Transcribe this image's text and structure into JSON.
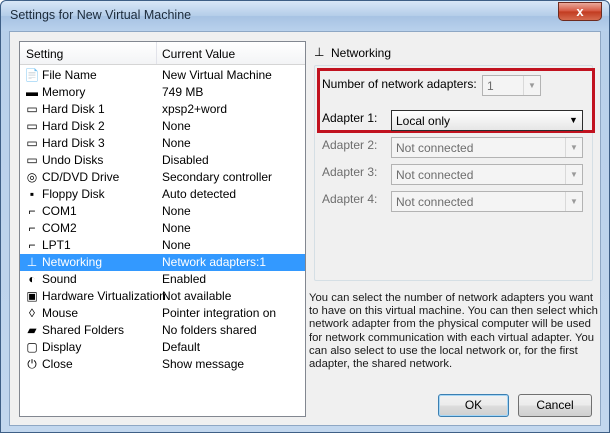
{
  "window": {
    "title": "Settings for New Virtual Machine",
    "close_glyph": "x"
  },
  "list": {
    "columns": [
      "Setting",
      "Current Value"
    ],
    "rows": [
      {
        "icon": "file-icon",
        "glyph": "📄",
        "name": "File Name",
        "value": "New Virtual Machine",
        "selected": false
      },
      {
        "icon": "memory-icon",
        "glyph": "▬",
        "name": "Memory",
        "value": "749 MB",
        "selected": false
      },
      {
        "icon": "hard-disk-icon",
        "glyph": "▭",
        "name": "Hard Disk 1",
        "value": "xpsp2+word",
        "selected": false
      },
      {
        "icon": "hard-disk-icon",
        "glyph": "▭",
        "name": "Hard Disk 2",
        "value": "None",
        "selected": false
      },
      {
        "icon": "hard-disk-icon",
        "glyph": "▭",
        "name": "Hard Disk 3",
        "value": "None",
        "selected": false
      },
      {
        "icon": "undo-disks-icon",
        "glyph": "▭",
        "name": "Undo Disks",
        "value": "Disabled",
        "selected": false
      },
      {
        "icon": "cd-dvd-icon",
        "glyph": "◎",
        "name": "CD/DVD Drive",
        "value": "Secondary controller",
        "selected": false
      },
      {
        "icon": "floppy-disk-icon",
        "glyph": "▪",
        "name": "Floppy Disk",
        "value": "Auto detected",
        "selected": false
      },
      {
        "icon": "com-port-icon",
        "glyph": "⌐",
        "name": "COM1",
        "value": "None",
        "selected": false
      },
      {
        "icon": "com-port-icon",
        "glyph": "⌐",
        "name": "COM2",
        "value": "None",
        "selected": false
      },
      {
        "icon": "lpt-port-icon",
        "glyph": "⌐",
        "name": "LPT1",
        "value": "None",
        "selected": false
      },
      {
        "icon": "networking-icon",
        "glyph": "⊥",
        "name": "Networking",
        "value": "Network adapters:1",
        "selected": true
      },
      {
        "icon": "sound-icon",
        "glyph": "◐",
        "name": "Sound",
        "value": "Enabled",
        "selected": false
      },
      {
        "icon": "hardware-virtualization-icon",
        "glyph": "▣",
        "name": "Hardware Virtualization",
        "value": "Not available",
        "selected": false
      },
      {
        "icon": "mouse-icon",
        "glyph": "◊",
        "name": "Mouse",
        "value": "Pointer integration on",
        "selected": false
      },
      {
        "icon": "shared-folders-icon",
        "glyph": "▰",
        "name": "Shared Folders",
        "value": "No folders shared",
        "selected": false
      },
      {
        "icon": "display-icon",
        "glyph": "▢",
        "name": "Display",
        "value": "Default",
        "selected": false
      },
      {
        "icon": "close-icon",
        "glyph": "⏻",
        "name": "Close",
        "value": "Show message",
        "selected": false
      }
    ]
  },
  "networking": {
    "group_title": "Networking",
    "adapters_count_label": "Number of network adapters:",
    "adapters_count_value": "1",
    "adapter1_label": "Adapter 1:",
    "adapter1_value": "Local only",
    "adapter2_label": "Adapter 2:",
    "adapter2_value": "Not connected",
    "adapter3_label": "Adapter 3:",
    "adapter3_value": "Not connected",
    "adapter4_label": "Adapter 4:",
    "adapter4_value": "Not connected",
    "description": "You can select the number of network adapters you want to have on this virtual machine. You can then select which network adapter from the physical computer will be used for network communication with each virtual adapter. You can also select to use the local network or, for the first adapter, the shared network."
  },
  "buttons": {
    "ok": "OK",
    "cancel": "Cancel"
  },
  "colors": {
    "selection": "#3399ff",
    "highlight_box": "#c1121f"
  }
}
